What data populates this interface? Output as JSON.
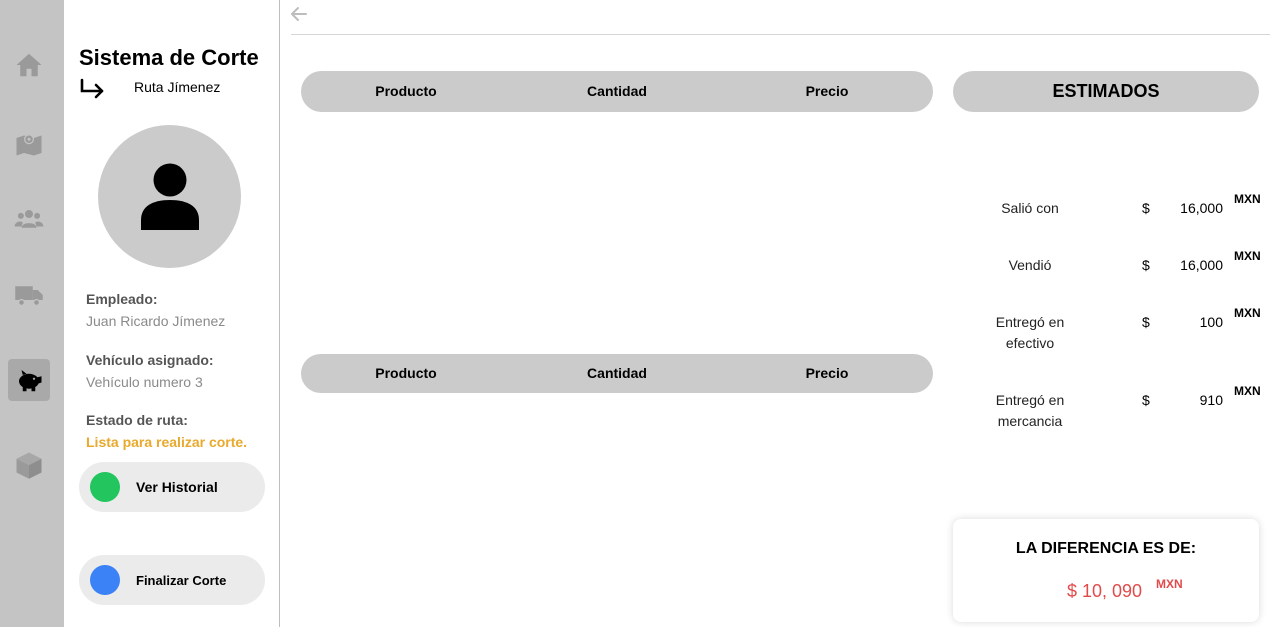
{
  "nav": {
    "items": [
      {
        "icon": "home-icon",
        "active": false
      },
      {
        "icon": "map-icon",
        "active": false
      },
      {
        "icon": "users-icon",
        "active": false
      },
      {
        "icon": "truck-icon",
        "active": false
      },
      {
        "icon": "piggy-bank-icon",
        "active": true
      },
      {
        "icon": "box-icon",
        "active": false
      }
    ]
  },
  "sidebar": {
    "title": "Sistema de Corte",
    "route": "Ruta Jímenez",
    "employee_label": "Empleado:",
    "employee_value": "Juan Ricardo Jímenez",
    "vehicle_label": "Vehículo asignado:",
    "vehicle_value": "Vehículo numero 3",
    "status_label": "Estado de ruta:",
    "status_value": "Lista para realizar corte.",
    "history_button": "Ver Historial",
    "finish_button": "Finalizar Corte",
    "colors": {
      "history_dot": "#22c55e",
      "finish_dot": "#3b82f6",
      "status": "#e9a92c"
    }
  },
  "tables": [
    {
      "columns": [
        "Producto",
        "Cantidad",
        "Precio"
      ]
    },
    {
      "columns": [
        "Producto",
        "Cantidad",
        "Precio"
      ]
    }
  ],
  "estimates": {
    "title": "ESTIMADOS",
    "rows": [
      {
        "label": "Salió con",
        "currency": "$",
        "amount": "16,000",
        "unit": "MXN"
      },
      {
        "label": "Vendió",
        "currency": "$",
        "amount": "16,000",
        "unit": "MXN"
      },
      {
        "label": "Entregó en efectivo",
        "currency": "$",
        "amount": "100",
        "unit": "MXN"
      },
      {
        "label": "Entregó en mercancia",
        "currency": "$",
        "amount": "910",
        "unit": "MXN"
      }
    ]
  },
  "difference": {
    "title": "LA DIFERENCIA ES DE:",
    "value": "$ 10, 090",
    "unit": "MXN",
    "color": "#e24b4b"
  }
}
